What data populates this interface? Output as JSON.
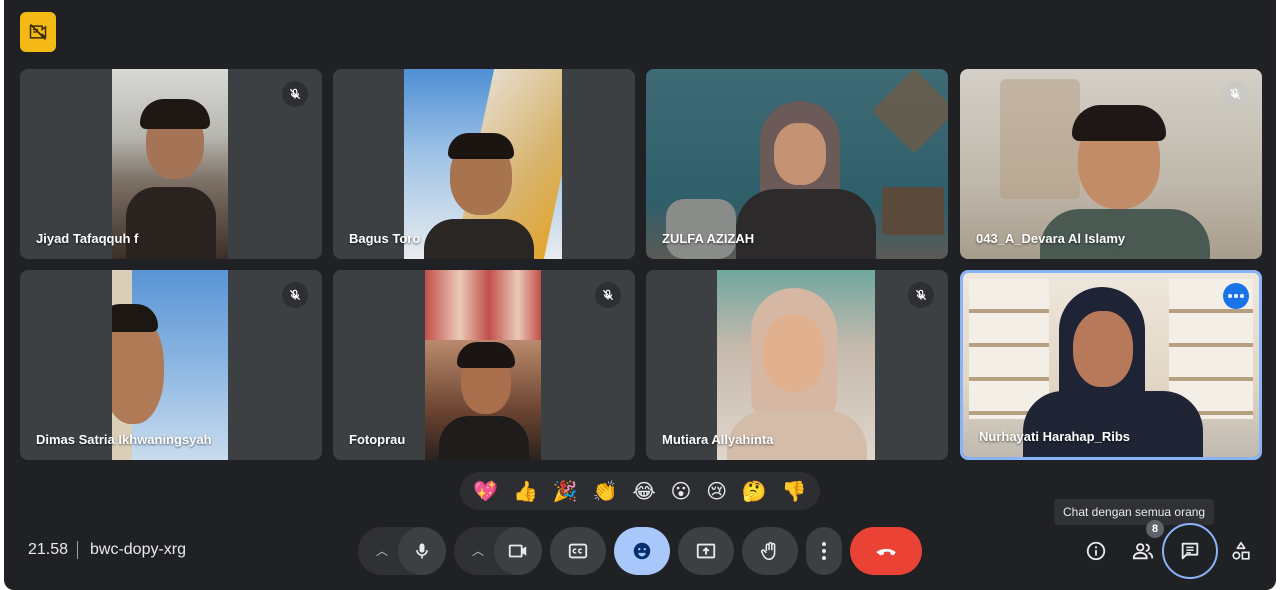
{
  "meeting": {
    "time": "21.58",
    "code": "bwc-dopy-xrg",
    "participant_count": "8"
  },
  "tooltip": "Chat dengan semua orang",
  "participants": [
    {
      "name": "Jiyad Tafaqquh f",
      "muted": true
    },
    {
      "name": "Bagus Toro",
      "muted": false
    },
    {
      "name": "ZULFA AZIZAH",
      "muted": false
    },
    {
      "name": "043_A_Devara Al Islamy",
      "muted": true
    },
    {
      "name": "Dimas Satria Ikhwaningsyah",
      "muted": true
    },
    {
      "name": "Fotoprau",
      "muted": true
    },
    {
      "name": "Mutiara Allyahinta",
      "muted": true
    },
    {
      "name": "Nurhayati Harahap_Ribs",
      "muted": false,
      "active_speaker": true
    }
  ],
  "reactions": [
    "💖",
    "👍",
    "🎉",
    "👏",
    "😂",
    "😮",
    "😢",
    "🤔",
    "👎"
  ],
  "icons": {
    "top": "no-camera-badge-icon",
    "controls": [
      "chevron-up-icon",
      "mic-icon",
      "chevron-up-icon",
      "camera-icon",
      "captions-icon",
      "emoji-icon",
      "present-icon",
      "raise-hand-icon",
      "more-vert-icon",
      "hang-up-icon"
    ],
    "right": [
      "info-icon",
      "people-icon",
      "chat-icon",
      "activities-icon"
    ]
  },
  "colors": {
    "background": "#202124",
    "tile": "#3c4043",
    "accent": "#8ab4f8",
    "emoji_active": "#a8c7fa",
    "hangup": "#ea4335",
    "badge": "#f5b916"
  }
}
